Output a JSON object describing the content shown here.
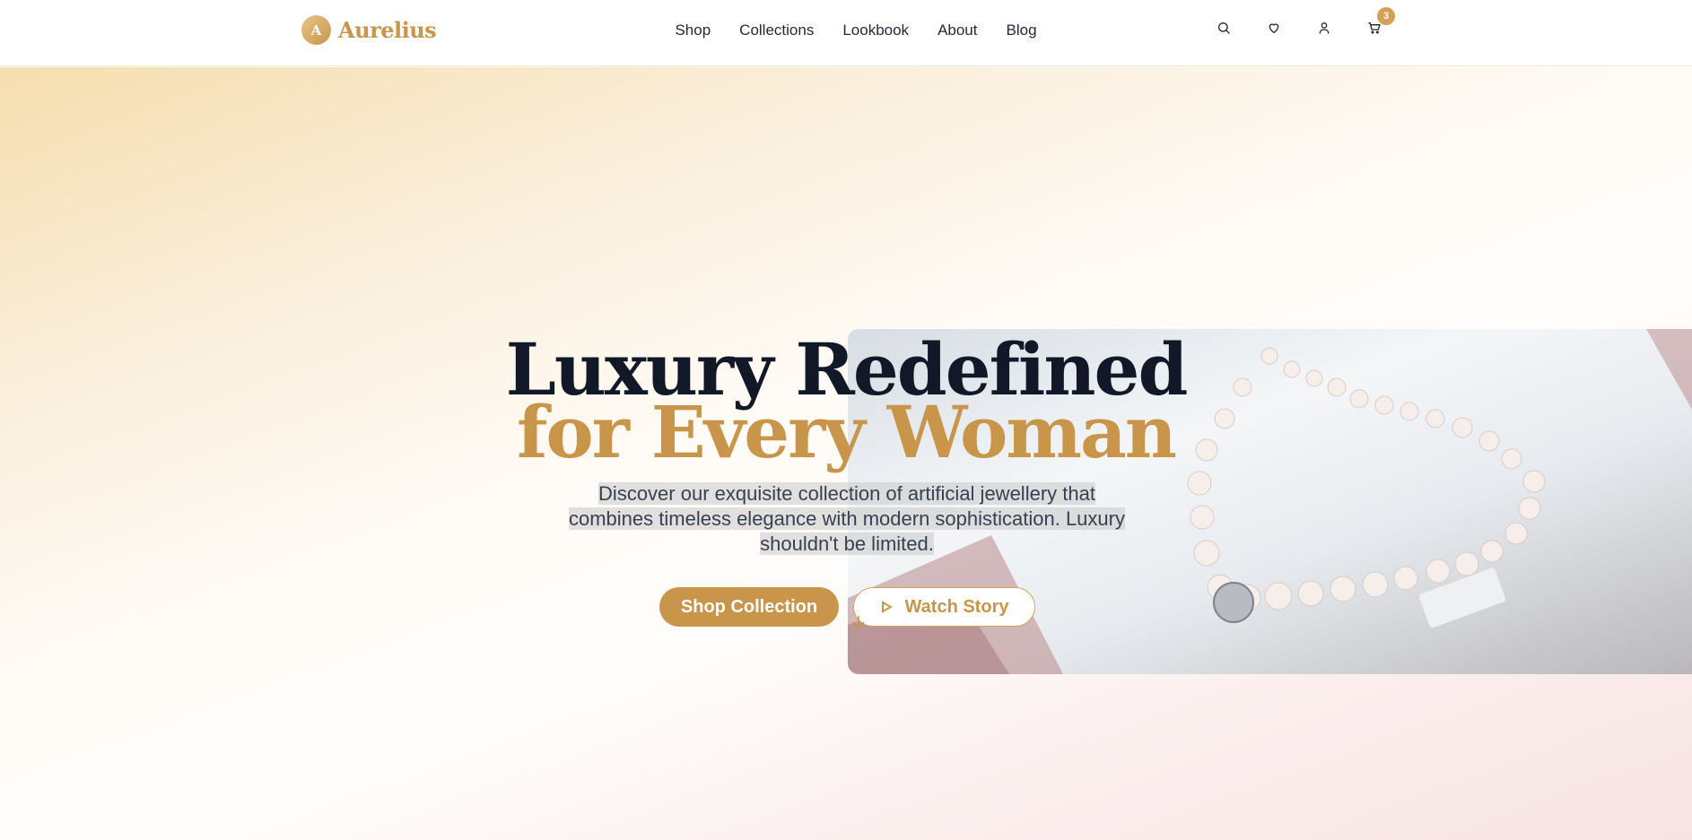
{
  "header": {
    "logo_letter": "A",
    "logo_text": "Aurelius",
    "nav": [
      "Shop",
      "Collections",
      "Lookbook",
      "About",
      "Blog"
    ],
    "cart_count": "3"
  },
  "hero": {
    "title_line1": "Luxury Redefined",
    "title_line2": "for Every Woman",
    "description": "Discover our exquisite collection of artificial jewellery that combines timeless elegance with modern sophistication. Luxury shouldn't be limited.",
    "primary_button": "Shop Collection",
    "secondary_button": "Watch Story"
  },
  "colors": {
    "accent": "#c8954a",
    "heading": "#111827",
    "text": "#374151"
  },
  "icons": [
    "search-icon",
    "heart-icon",
    "user-icon",
    "cart-icon",
    "play-icon",
    "arrow-down-icon"
  ]
}
